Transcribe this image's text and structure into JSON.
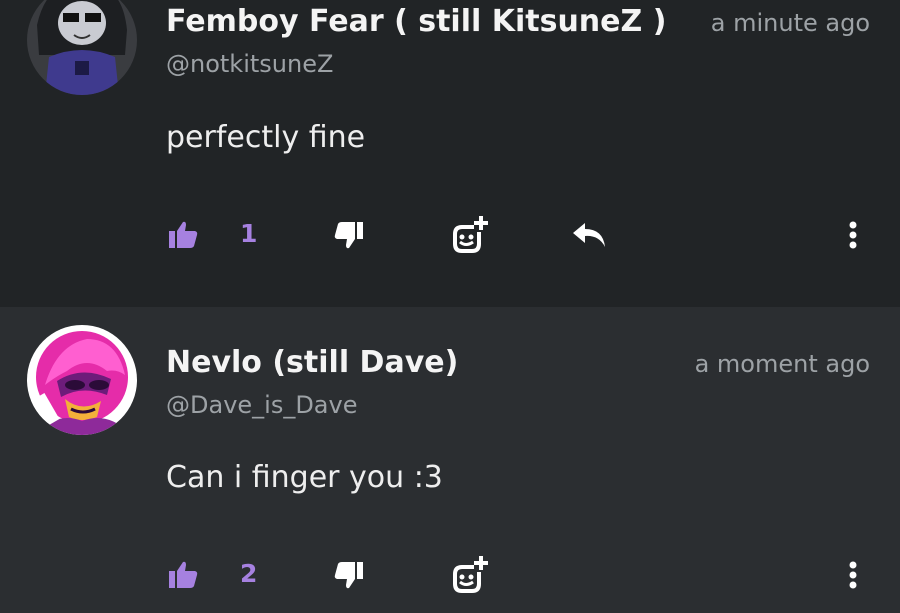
{
  "colors": {
    "accent": "#a681e0",
    "bg_1": "#212426",
    "bg_2": "#2b2e31",
    "muted": "#9da2a6"
  },
  "comments": [
    {
      "author": "Femboy Fear ( still KitsuneZ )",
      "handle": "@notkitsuneZ",
      "time": "a minute ago",
      "text": "perfectly fine",
      "likes": "1",
      "icons": [
        "thumbs-up-icon",
        "thumbs-down-icon",
        "add-reaction-icon",
        "reply-icon",
        "more-vertical-icon"
      ]
    },
    {
      "author": "Nevlo (still Dave)",
      "handle": "@Dave_is_Dave",
      "time": "a moment ago",
      "text": "Can i finger you :3",
      "likes": "2",
      "icons": [
        "thumbs-up-icon",
        "thumbs-down-icon",
        "add-reaction-icon",
        "more-vertical-icon"
      ]
    }
  ]
}
